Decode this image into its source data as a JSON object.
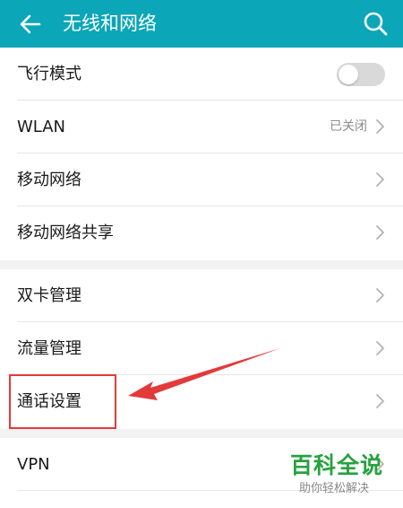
{
  "header": {
    "title": "无线和网络",
    "back_icon": "arrow-left-icon",
    "search_icon": "search-icon",
    "background": "#0ba6b7"
  },
  "groups": [
    {
      "items": [
        {
          "label": "飞行模式",
          "control": "toggle",
          "toggle_on": false
        },
        {
          "label": "WLAN",
          "status": "已关闭",
          "control": "chevron"
        },
        {
          "label": "移动网络",
          "control": "chevron"
        },
        {
          "label": "移动网络共享",
          "control": "chevron"
        }
      ]
    },
    {
      "items": [
        {
          "label": "双卡管理",
          "control": "chevron"
        },
        {
          "label": "流量管理",
          "control": "chevron"
        },
        {
          "label": "通话设置",
          "control": "chevron",
          "highlighted": true
        }
      ]
    },
    {
      "items": [
        {
          "label": "VPN",
          "control": "chevron"
        }
      ]
    }
  ],
  "annotation": {
    "highlight_color": "#e23a3a",
    "target": "通话设置"
  },
  "watermark": {
    "main": "百科全说",
    "sub": "助你轻松解决",
    "color": "#26a23f"
  }
}
